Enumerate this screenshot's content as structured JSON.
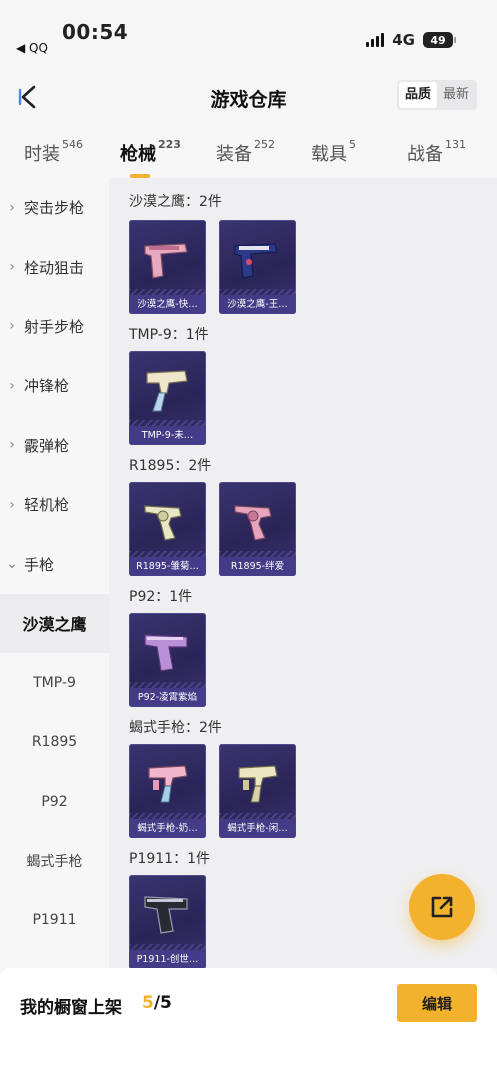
{
  "status_bar": {
    "time": "00:54",
    "back_app": "◀ QQ",
    "network": "4G",
    "battery": "49"
  },
  "header": {
    "title": "游戏仓库",
    "sort": [
      "品质",
      "最新"
    ],
    "sort_active": "品质"
  },
  "tabs": [
    {
      "label": "时装",
      "count": "546"
    },
    {
      "label": "枪械",
      "count": "223"
    },
    {
      "label": "装备",
      "count": "252"
    },
    {
      "label": "载具",
      "count": "5"
    },
    {
      "label": "战备",
      "count": "131"
    }
  ],
  "active_tab": "枪械",
  "sidebar": {
    "categories": [
      "突击步枪",
      "栓动狙击",
      "射手步枪",
      "冲锋枪",
      "霰弹枪",
      "轻机枪",
      "手枪"
    ],
    "expanded": "手枪",
    "subitems": [
      "沙漠之鹰",
      "TMP-9",
      "R1895",
      "P92",
      "蝎式手枪",
      "P1911"
    ],
    "active_subitem": "沙漠之鹰"
  },
  "groups": [
    {
      "title": "沙漠之鹰：2件",
      "items": [
        {
          "label": "沙漠之鹰-快…",
          "icon": "desert-eagle-pink"
        },
        {
          "label": "沙漠之鹰-王…",
          "icon": "desert-eagle-navy"
        }
      ]
    },
    {
      "title": "TMP-9：1件",
      "items": [
        {
          "label": "TMP-9-未…",
          "icon": "tmp9-cream"
        }
      ]
    },
    {
      "title": "R1895：2件",
      "items": [
        {
          "label": "R1895-雏菊…",
          "icon": "revolver-cream"
        },
        {
          "label": "R1895-绊爱",
          "icon": "revolver-pink"
        }
      ]
    },
    {
      "title": "P92：1件",
      "items": [
        {
          "label": "P92-凌霄紫焰",
          "icon": "pistol-purple"
        }
      ]
    },
    {
      "title": "蝎式手枪：2件",
      "items": [
        {
          "label": "蝎式手枪-奶…",
          "icon": "scorpion-pink"
        },
        {
          "label": "蝎式手枪-闲…",
          "icon": "scorpion-cream"
        }
      ]
    },
    {
      "title": "P1911：1件",
      "items": [
        {
          "label": "P1911-创世…",
          "icon": "pistol-dark"
        }
      ]
    }
  ],
  "bottom_bar": {
    "label": "我的橱窗上架",
    "count_current": "5",
    "count_total": "/5",
    "edit_label": "编辑"
  },
  "colors": {
    "accent": "#f3b22d",
    "card_bg": "#2d2860",
    "card_label_bg": "#463e8c"
  }
}
